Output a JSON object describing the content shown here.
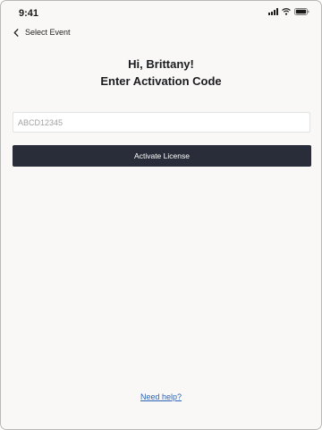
{
  "status_bar": {
    "time": "9:41",
    "icons": [
      "signal-icon",
      "wifi-icon",
      "battery-icon"
    ]
  },
  "nav": {
    "back_icon": "chevron-left-icon",
    "back_label": "Select Event"
  },
  "heading": {
    "greeting": "Hi, Brittany!",
    "title": "Enter Activation Code"
  },
  "form": {
    "code_value": "",
    "code_placeholder": "ABCD12345",
    "submit_label": "Activate License"
  },
  "footer": {
    "help_label": "Need help?"
  },
  "colors": {
    "background": "#f9f8f6",
    "button": "#292d39",
    "link": "#2f63b5"
  }
}
